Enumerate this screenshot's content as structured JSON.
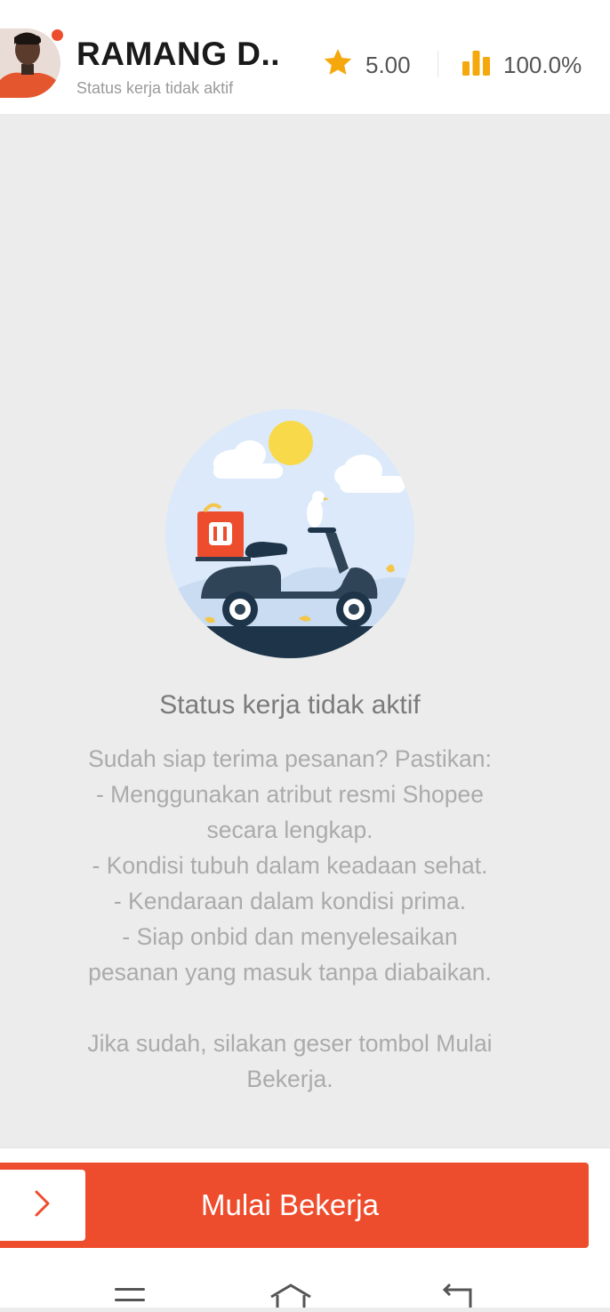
{
  "header": {
    "driver_name": "RAMANG D..",
    "work_status": "Status kerja tidak aktif",
    "rating": "5.00",
    "acceptance_rate": "100.0%"
  },
  "colors": {
    "brand": "#ee4d2d",
    "star": "#f4a80c"
  },
  "icons": {
    "rating": "star-icon",
    "acceptance": "bar-chart-icon",
    "slider": "chevron-right-icon",
    "nav": [
      "menu-icon",
      "home-icon",
      "back-icon"
    ]
  },
  "empty_state": {
    "title": "Status kerja tidak aktif",
    "lines": [
      "Sudah siap terima pesanan? Pastikan:",
      "- Menggunakan atribut resmi Shopee",
      "secara lengkap.",
      "- Kondisi tubuh dalam keadaan sehat.",
      "- Kendaraan dalam kondisi prima.",
      "- Siap onbid dan menyelesaikan",
      "pesanan yang masuk tanpa diabaikan."
    ],
    "lines2": [
      "Jika sudah, silakan geser tombol Mulai",
      "Bekerja."
    ]
  },
  "action": {
    "start_label": "Mulai Bekerja"
  }
}
